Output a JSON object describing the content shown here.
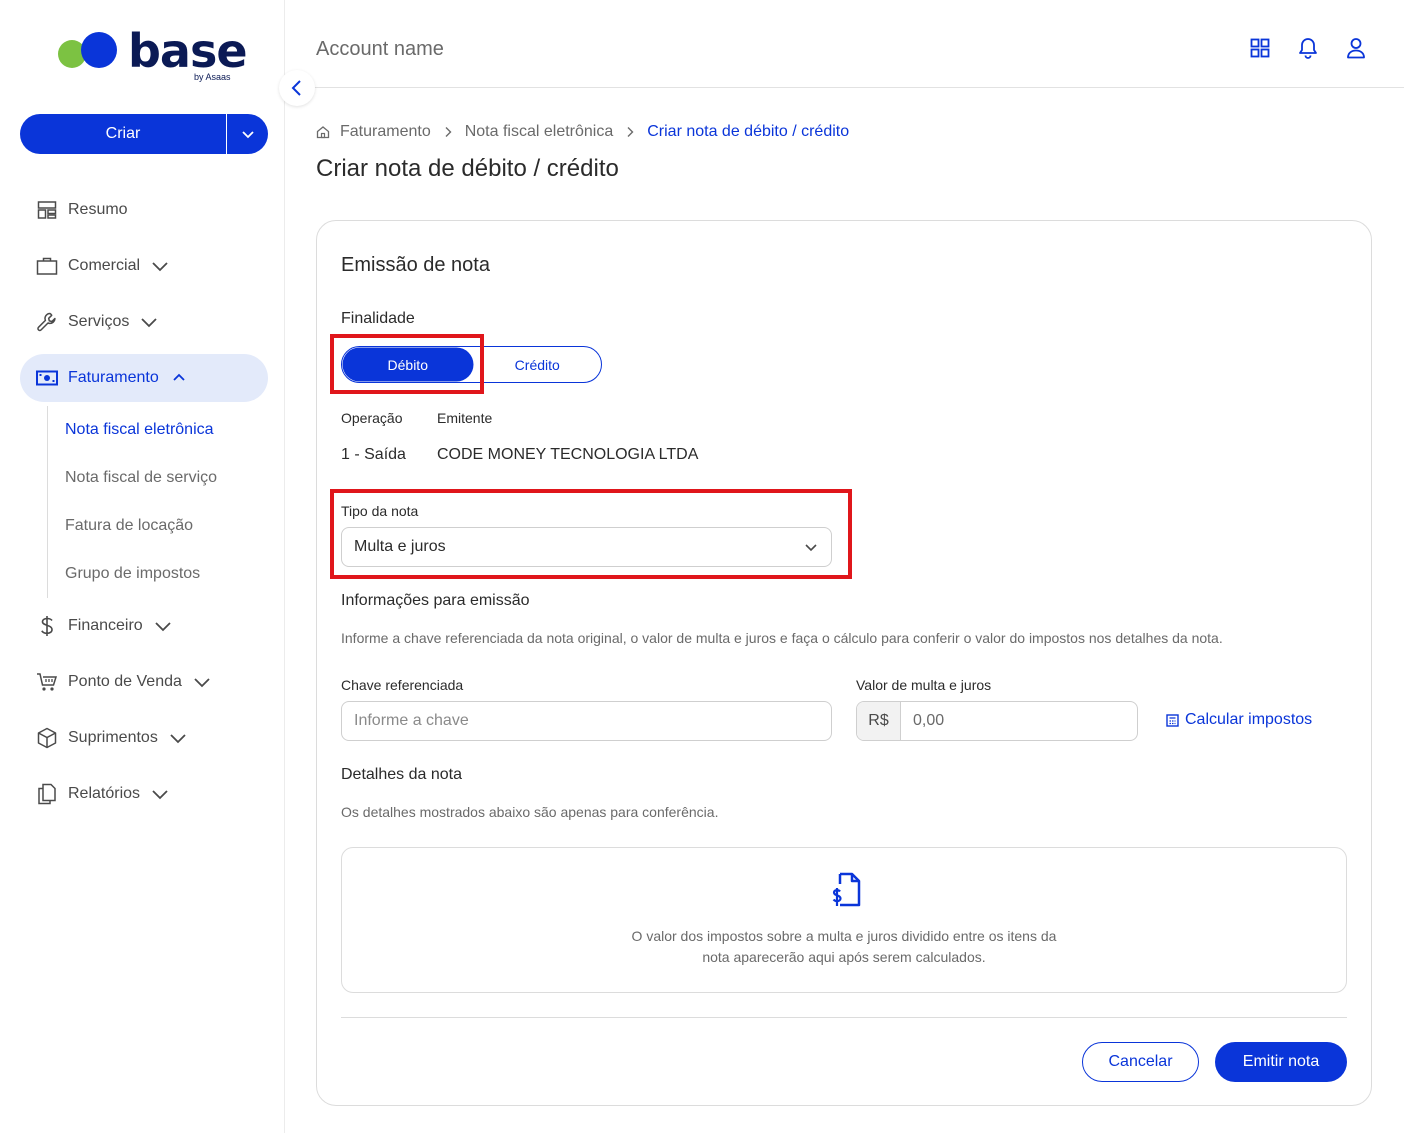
{
  "brand": {
    "name": "base",
    "sub": "by Asaas"
  },
  "sidebar": {
    "create_label": "Criar",
    "items": [
      {
        "label": "Resumo",
        "icon": "layout-icon"
      },
      {
        "label": "Comercial",
        "icon": "briefcase-icon"
      },
      {
        "label": "Serviços",
        "icon": "wrench-icon"
      },
      {
        "label": "Faturamento",
        "icon": "banknote-icon"
      },
      {
        "label": "Financeiro",
        "icon": "dollar-icon"
      },
      {
        "label": "Ponto de Venda",
        "icon": "cart-icon"
      },
      {
        "label": "Suprimentos",
        "icon": "package-icon"
      },
      {
        "label": "Relatórios",
        "icon": "document-copy-icon"
      }
    ],
    "subitems": [
      {
        "label": "Nota fiscal eletrônica"
      },
      {
        "label": "Nota fiscal de serviço"
      },
      {
        "label": "Fatura de locação"
      },
      {
        "label": "Grupo de impostos"
      }
    ]
  },
  "header": {
    "account_name": "Account name"
  },
  "breadcrumb": [
    "Faturamento",
    "Nota fiscal eletrônica",
    "Criar nota de débito / crédito"
  ],
  "page_title": "Criar nota de débito / crédito",
  "form": {
    "section_title": "Emissão de nota",
    "finalidade_label": "Finalidade",
    "finalidade_options": [
      "Débito",
      "Crédito"
    ],
    "finalidade_selected": "Débito",
    "operacao_label": "Operação",
    "operacao_value": "1 - Saída",
    "emitente_label": "Emitente",
    "emitente_value": "CODE MONEY TECNOLOGIA LTDA",
    "tipo_label": "Tipo da nota",
    "tipo_value": "Multa e juros",
    "info_title": "Informações para emissão",
    "info_desc": "Informe a chave referenciada da nota original, o valor de multa e juros e faça o cálculo para conferir o valor do impostos nos detalhes da nota.",
    "chave_label": "Chave referenciada",
    "chave_placeholder": "Informe a chave",
    "valor_label": "Valor de multa e juros",
    "valor_prefix": "R$",
    "valor_value": "0,00",
    "calc_label": "Calcular impostos",
    "details_title": "Detalhes da nota",
    "details_desc": "Os detalhes mostrados abaixo são apenas para conferência.",
    "details_msg_line1": "O valor dos impostos sobre a multa e juros dividido entre os itens da",
    "details_msg_line2": "nota aparecerão aqui após serem calculados.",
    "cancel_label": "Cancelar",
    "submit_label": "Emitir nota"
  },
  "colors": {
    "primary": "#0a35d9",
    "highlight": "#e0161b",
    "active_bg": "#e3eafa"
  }
}
